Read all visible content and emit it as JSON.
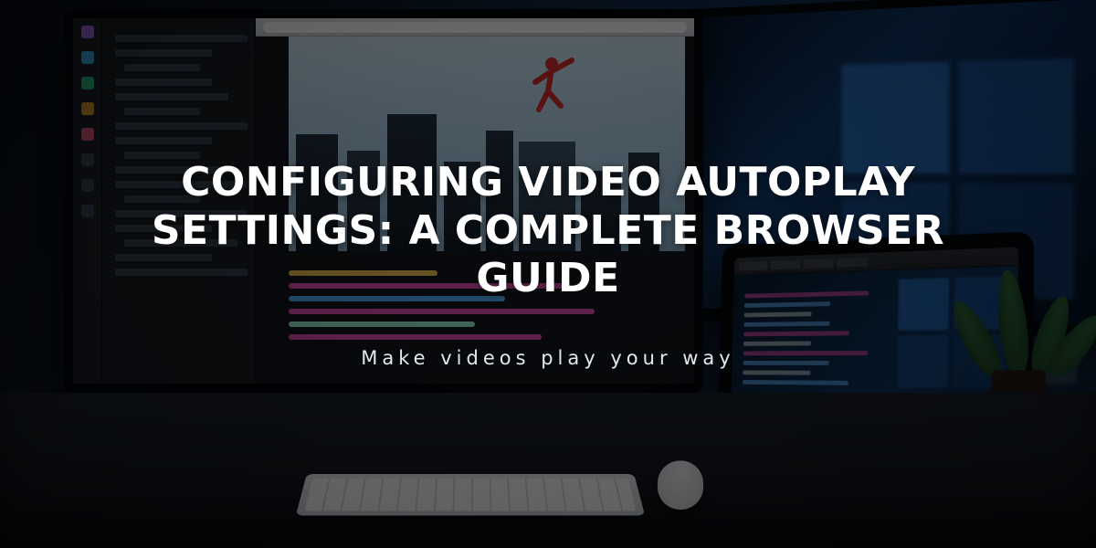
{
  "hero": {
    "title": "CONFIGURING VIDEO AUTOPLAY SETTINGS: A COMPLETE BROWSER GUIDE",
    "tagline": "Make videos play your way"
  }
}
